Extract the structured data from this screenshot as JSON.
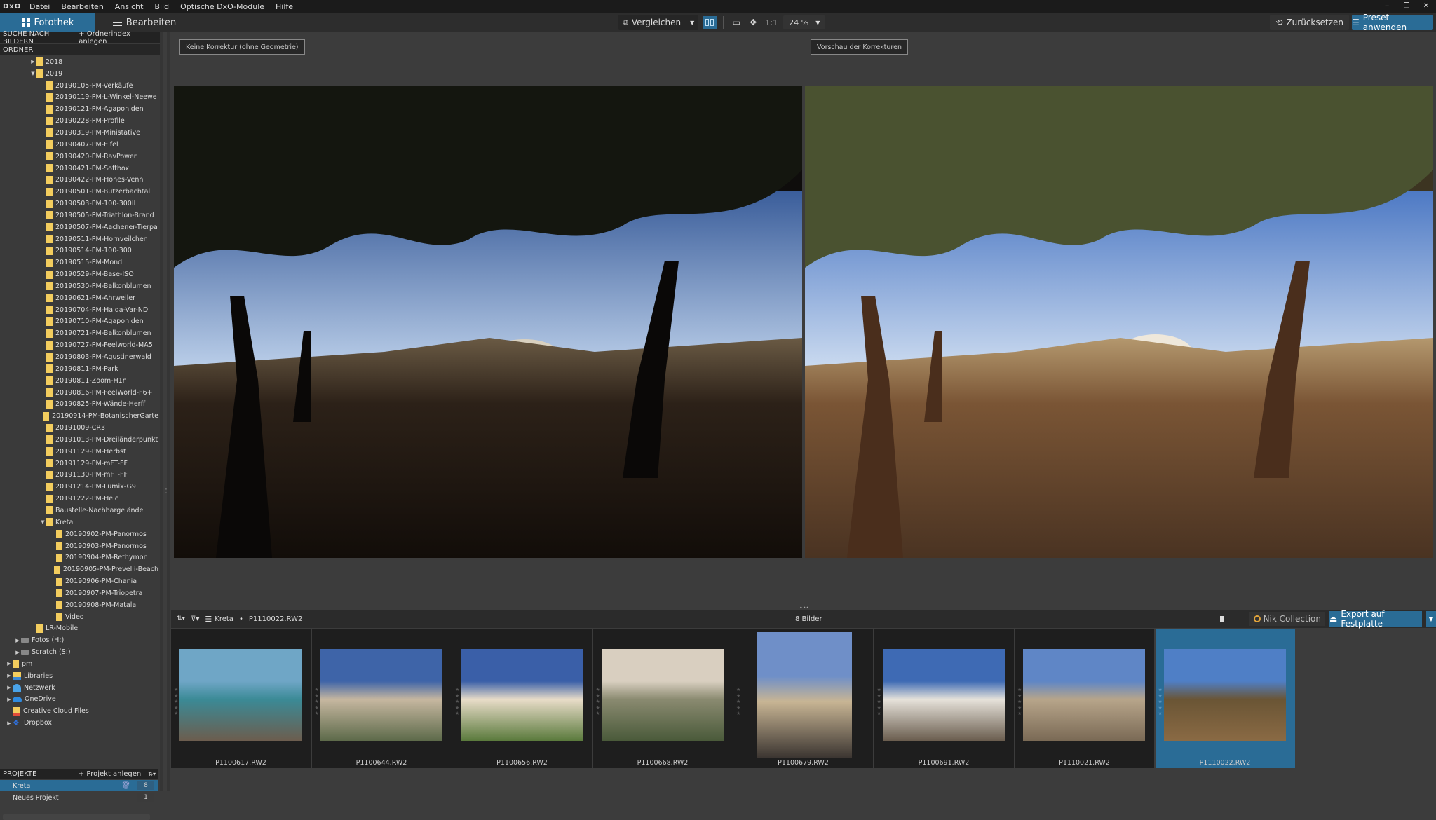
{
  "app": {
    "logo": "DxO",
    "menu": [
      "Datei",
      "Bearbeiten",
      "Ansicht",
      "Bild",
      "Optische DxO-Module",
      "Hilfe"
    ],
    "window_controls": [
      "minimize",
      "restore",
      "close"
    ]
  },
  "toolbar": {
    "tab_library": "Fotothek",
    "tab_edit": "Bearbeiten",
    "compare_label": "Vergleichen",
    "zoom_ratio": "1:1",
    "zoom_level": "24 %",
    "reset_label": "Zurücksetzen",
    "preset_label": "Preset anwenden"
  },
  "sidebar": {
    "search_label": "SUCHE NACH BILDERN",
    "index_label": "+ Ordnerindex anlegen",
    "folders_label": "ORDNER",
    "tree": [
      {
        "label": "2018",
        "level": 1,
        "arrow": "▶",
        "icon": "folder"
      },
      {
        "label": "2019",
        "level": 1,
        "arrow": "▼",
        "icon": "folder"
      },
      {
        "label": "20190105-PM-Verkäufe",
        "level": 2,
        "icon": "folder"
      },
      {
        "label": "20190119-PM-L-Winkel-Neewe",
        "level": 2,
        "icon": "folder"
      },
      {
        "label": "20190121-PM-Agaponiden",
        "level": 2,
        "icon": "folder"
      },
      {
        "label": "20190228-PM-Profile",
        "level": 2,
        "icon": "folder"
      },
      {
        "label": "20190319-PM-Ministative",
        "level": 2,
        "icon": "folder"
      },
      {
        "label": "20190407-PM-Eifel",
        "level": 2,
        "icon": "folder"
      },
      {
        "label": "20190420-PM-RavPower",
        "level": 2,
        "icon": "folder"
      },
      {
        "label": "20190421-PM-Softbox",
        "level": 2,
        "icon": "folder"
      },
      {
        "label": "20190422-PM-Hohes-Venn",
        "level": 2,
        "icon": "folder"
      },
      {
        "label": "20190501-PM-Butzerbachtal",
        "level": 2,
        "icon": "folder"
      },
      {
        "label": "20190503-PM-100-300II",
        "level": 2,
        "icon": "folder"
      },
      {
        "label": "20190505-PM-Triathlon-Brand",
        "level": 2,
        "icon": "folder"
      },
      {
        "label": "20190507-PM-Aachener-Tierpa",
        "level": 2,
        "icon": "folder"
      },
      {
        "label": "20190511-PM-Hornveilchen",
        "level": 2,
        "icon": "folder"
      },
      {
        "label": "20190514-PM-100-300",
        "level": 2,
        "icon": "folder"
      },
      {
        "label": "20190515-PM-Mond",
        "level": 2,
        "icon": "folder"
      },
      {
        "label": "20190529-PM-Base-ISO",
        "level": 2,
        "icon": "folder"
      },
      {
        "label": "20190530-PM-Balkonblumen",
        "level": 2,
        "icon": "folder"
      },
      {
        "label": "20190621-PM-Ahrweiler",
        "level": 2,
        "icon": "folder"
      },
      {
        "label": "20190704-PM-Haida-Var-ND",
        "level": 2,
        "icon": "folder"
      },
      {
        "label": "20190710-PM-Agaponiden",
        "level": 2,
        "icon": "folder"
      },
      {
        "label": "20190721-PM-Balkonblumen",
        "level": 2,
        "icon": "folder"
      },
      {
        "label": "20190727-PM-Feelworld-MA5",
        "level": 2,
        "icon": "folder"
      },
      {
        "label": "20190803-PM-Agustinerwald",
        "level": 2,
        "icon": "folder"
      },
      {
        "label": "20190811-PM-Park",
        "level": 2,
        "icon": "folder"
      },
      {
        "label": "20190811-Zoom-H1n",
        "level": 2,
        "icon": "folder"
      },
      {
        "label": "20190816-PM-FeelWorld-F6+",
        "level": 2,
        "icon": "folder"
      },
      {
        "label": "20190825-PM-Wände-Herff",
        "level": 2,
        "icon": "folder"
      },
      {
        "label": "20190914-PM-BotanischerGarte",
        "level": 2,
        "icon": "folder"
      },
      {
        "label": "20191009-CR3",
        "level": 2,
        "icon": "folder"
      },
      {
        "label": "20191013-PM-Dreiländerpunkt",
        "level": 2,
        "icon": "folder"
      },
      {
        "label": "20191129-PM-Herbst",
        "level": 2,
        "icon": "folder"
      },
      {
        "label": "20191129-PM-mFT-FF",
        "level": 2,
        "icon": "folder"
      },
      {
        "label": "20191130-PM-mFT-FF",
        "level": 2,
        "icon": "folder"
      },
      {
        "label": "20191214-PM-Lumix-G9",
        "level": 2,
        "icon": "folder"
      },
      {
        "label": "20191222-PM-Heic",
        "level": 2,
        "icon": "folder"
      },
      {
        "label": "Baustelle-Nachbargelände",
        "level": 2,
        "icon": "folder"
      },
      {
        "label": "Kreta",
        "level": 2,
        "arrow": "▼",
        "icon": "folder"
      },
      {
        "label": "20190902-PM-Panormos",
        "level": 3,
        "icon": "folder"
      },
      {
        "label": "20190903-PM-Panormos",
        "level": 3,
        "icon": "folder"
      },
      {
        "label": "20190904-PM-Rethymon",
        "level": 3,
        "icon": "folder"
      },
      {
        "label": "20190905-PM-Prevelli-Beach",
        "level": 3,
        "icon": "folder"
      },
      {
        "label": "20190906-PM-Chania",
        "level": 3,
        "icon": "folder"
      },
      {
        "label": "20190907-PM-Triopetra",
        "level": 3,
        "icon": "folder"
      },
      {
        "label": "20190908-PM-Matala",
        "level": 3,
        "icon": "folder"
      },
      {
        "label": "Video",
        "level": 3,
        "icon": "folder"
      },
      {
        "label": "LR-Mobile",
        "level": 1,
        "icon": "folder"
      },
      {
        "label": "Fotos (H:)",
        "level": 0.5,
        "arrow": "▶",
        "icon": "drive"
      },
      {
        "label": "Scratch (S:)",
        "level": 0.5,
        "arrow": "▶",
        "icon": "drive"
      },
      {
        "label": "pm",
        "level": 0,
        "arrow": "▶",
        "icon": "folder"
      },
      {
        "label": "Libraries",
        "level": 0,
        "arrow": "▶",
        "icon": "libraries"
      },
      {
        "label": "Netzwerk",
        "level": 0,
        "arrow": "▶",
        "icon": "network"
      },
      {
        "label": "OneDrive",
        "level": 0,
        "arrow": "▶",
        "icon": "onedrive"
      },
      {
        "label": "Creative Cloud Files",
        "level": 0,
        "icon": "creative-cloud"
      },
      {
        "label": "Dropbox",
        "level": 0,
        "arrow": "▶",
        "icon": "dropbox"
      }
    ],
    "projects_label": "PROJEKTE",
    "add_project_label": "+ Projekt anlegen",
    "projects": [
      {
        "name": "Kreta",
        "count": "8",
        "selected": true
      },
      {
        "name": "Neues Projekt",
        "count": "1",
        "selected": false
      }
    ]
  },
  "viewer": {
    "left_label": "Keine Korrektur (ohne Geometrie)",
    "right_label": "Vorschau der Korrekturen"
  },
  "filmstrip_bar": {
    "breadcrumb_project": "Kreta",
    "breadcrumb_sep": "•",
    "breadcrumb_file": "P1110022.RW2",
    "image_count": "8 Bilder",
    "nik_label": "Nik Collection",
    "export_label": "Export auf Festplatte"
  },
  "filmstrip": [
    {
      "name": "P1100617.RW2",
      "scene": "coast",
      "orientation": "landscape",
      "selected": false
    },
    {
      "name": "P1100644.RW2",
      "scene": "harbor",
      "orientation": "landscape",
      "selected": false
    },
    {
      "name": "P1100656.RW2",
      "scene": "chapel",
      "orientation": "landscape",
      "selected": false
    },
    {
      "name": "P1100668.RW2",
      "scene": "courtyard",
      "orientation": "landscape",
      "selected": false
    },
    {
      "name": "P1100679.RW2",
      "scene": "alley",
      "orientation": "portrait",
      "selected": false
    },
    {
      "name": "P1100691.RW2",
      "scene": "house",
      "orientation": "landscape",
      "selected": false
    },
    {
      "name": "P1110021.RW2",
      "scene": "rocks",
      "orientation": "landscape",
      "selected": false
    },
    {
      "name": "P1110022.RW2",
      "scene": "trees",
      "orientation": "landscape",
      "selected": true
    }
  ],
  "colors": {
    "accent": "#2a6c96",
    "folder": "#f3cd5e",
    "panel": "#3a3a3a",
    "menubar": "#1b1b1b"
  }
}
